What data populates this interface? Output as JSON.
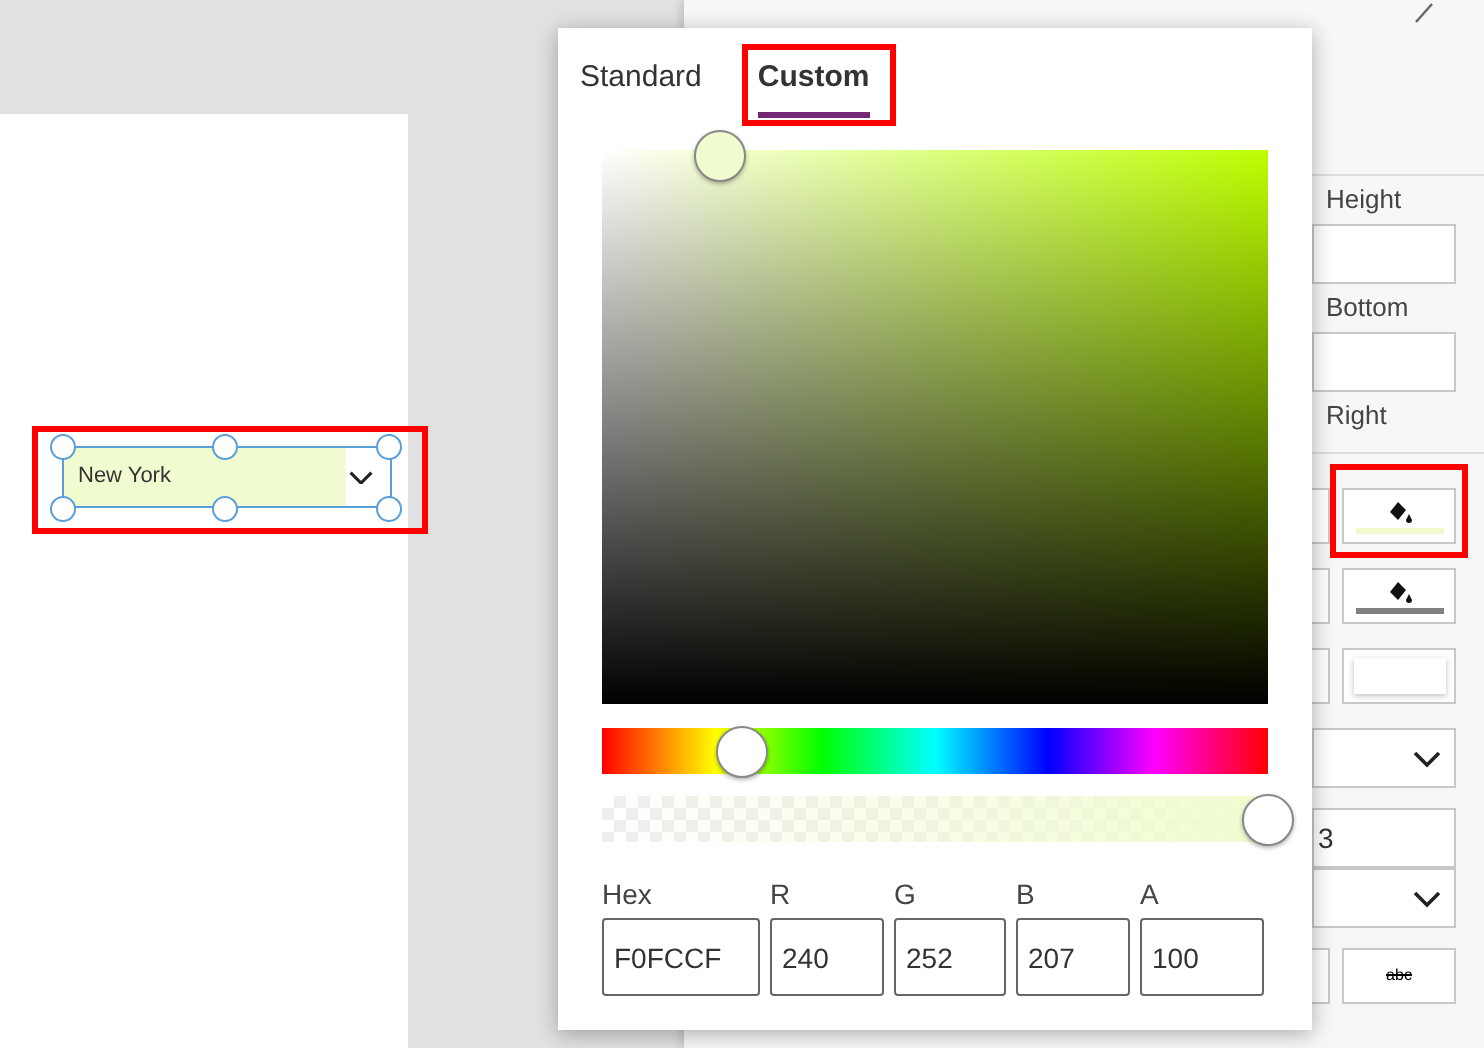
{
  "canvas": {
    "dropdown": {
      "value": "New York",
      "selected": true,
      "highlighted": true
    }
  },
  "property_panel": {
    "rows": [
      {
        "kind": "label",
        "text": "Height"
      },
      {
        "kind": "field"
      },
      {
        "kind": "label",
        "text": "Bottom"
      },
      {
        "kind": "field"
      },
      {
        "kind": "label",
        "text": "Right"
      },
      {
        "kind": "divider"
      },
      {
        "kind": "color-button",
        "color": "#f0fccf",
        "highlighted": true
      },
      {
        "kind": "color-button",
        "color": "#808080"
      },
      {
        "kind": "swatch-button"
      },
      {
        "kind": "dropdown"
      },
      {
        "kind": "field",
        "value": "3"
      },
      {
        "kind": "dropdown"
      },
      {
        "kind": "strike-button",
        "text": "abc"
      }
    ]
  },
  "color_picker": {
    "tabs": [
      {
        "label": "Standard",
        "selected": false
      },
      {
        "label": "Custom",
        "selected": true,
        "highlighted": true
      }
    ],
    "hue": {
      "level": 0.21
    },
    "alpha": {
      "level": 1
    },
    "fields": [
      {
        "label": "Hex",
        "value": "F0FCCF"
      },
      {
        "label": "R",
        "value": "240"
      },
      {
        "label": "G",
        "value": "252"
      },
      {
        "label": "B",
        "value": "207"
      },
      {
        "label": "A",
        "value": "100"
      }
    ]
  }
}
